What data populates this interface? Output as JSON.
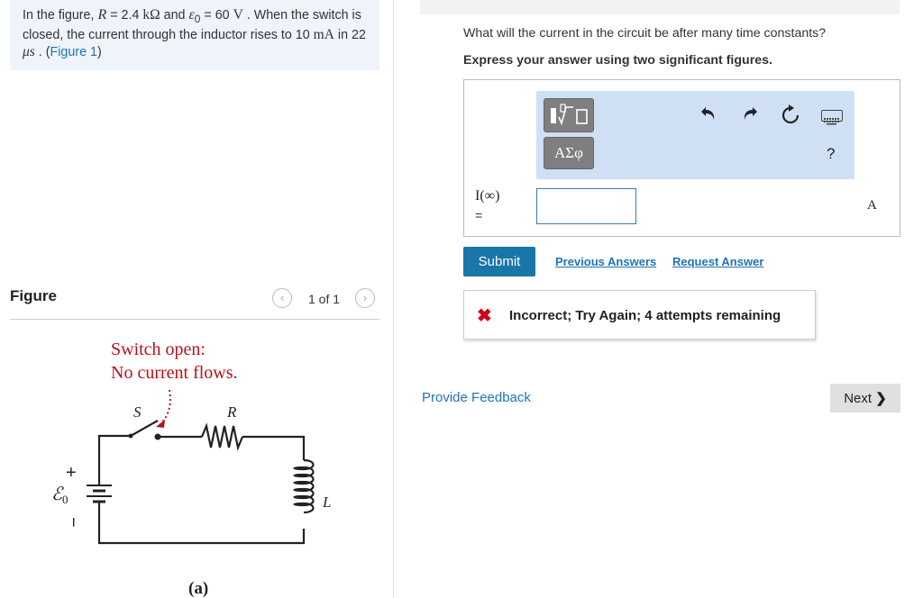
{
  "problem": {
    "p1": "In the figure, ",
    "R_sym": "R",
    "p2": " = 2.4 ",
    "R_unit": "kΩ",
    "p3": " and ",
    "emf_sym": "ε",
    "emf_sub": "0",
    "p4": " = 60 ",
    "emf_unit": "V",
    "p5": " . When the switch is closed, the current through the inductor rises to 10 ",
    "cur_unit": "mA",
    "p6": " in 22 ",
    "time_unit": "μs",
    "p7": " . (",
    "figure_link": "Figure 1",
    "p8": ")"
  },
  "figure_panel": {
    "title": "Figure",
    "count": "1 of 1",
    "prev_icon": "‹",
    "next_icon": "›"
  },
  "circuit": {
    "note_line1": "Switch open:",
    "note_line2": "No current flows.",
    "switch_label": "S",
    "resistor_label": "R",
    "inductor_label": "L",
    "emf_label": "ℰ",
    "emf_sub": "0",
    "plus": "+",
    "minus": "−",
    "caption": "(a)"
  },
  "question": {
    "text": "What will the current in the circuit be after many time constants?",
    "instruction": "Express your answer using two significant figures."
  },
  "toolbar": {
    "symbols_label": "ΑΣφ",
    "help_label": "?"
  },
  "answer": {
    "variable_label": "I(∞)",
    "equals": "=",
    "value": "",
    "unit": "A"
  },
  "actions": {
    "submit": "Submit",
    "previous_answers": "Previous Answers",
    "request_answer": "Request Answer"
  },
  "feedback": {
    "icon": "✖",
    "text": "Incorrect; Try Again; 4 attempts remaining"
  },
  "footer": {
    "provide_feedback": "Provide Feedback",
    "next": "Next",
    "next_icon": "❯"
  }
}
